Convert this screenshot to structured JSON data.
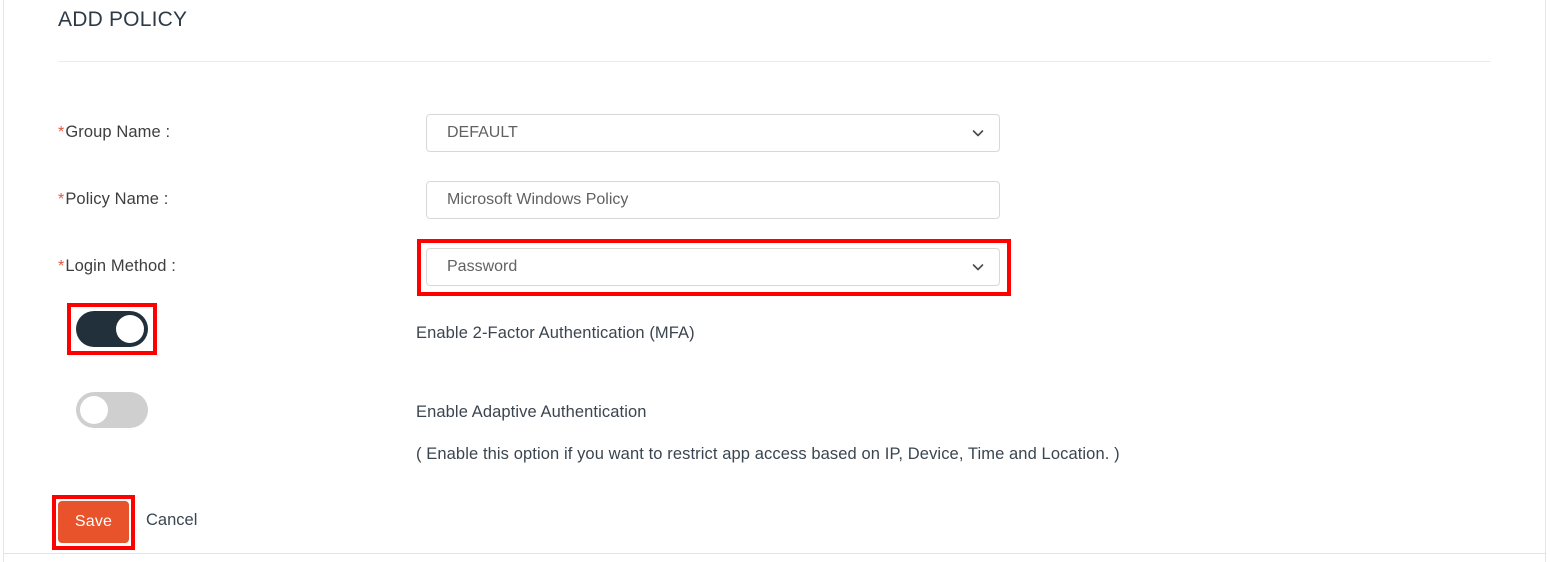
{
  "page": {
    "title": "ADD POLICY"
  },
  "form": {
    "fields": [
      {
        "label": "Group Name :",
        "required_marker": "*",
        "type": "select",
        "value": "DEFAULT",
        "icon": "chevron-down-icon"
      },
      {
        "label": "Policy Name :",
        "required_marker": "*",
        "type": "text",
        "value": "Microsoft Windows Policy",
        "placeholder": "Policy Name"
      },
      {
        "label": "Login Method :",
        "required_marker": "*",
        "type": "select",
        "value": "Password",
        "icon": "chevron-down-icon",
        "highlighted": true
      }
    ],
    "toggles": [
      {
        "label": "Enable 2-Factor Authentication (MFA)",
        "state": "on",
        "highlighted": true
      },
      {
        "label": "Enable Adaptive Authentication",
        "state": "off",
        "hint": "( Enable this option if you want to restrict app access based on IP, Device, Time and Location. )"
      }
    ]
  },
  "actions": {
    "save_label": "Save",
    "cancel_label": "Cancel"
  },
  "colors": {
    "accent_orange": "#e8532b",
    "toggle_on": "#22303c",
    "toggle_off": "#cfcfcf",
    "required_asterisk": "#e8553f",
    "annotation_red": "#ff0000",
    "title_text": "#2e3b47"
  }
}
